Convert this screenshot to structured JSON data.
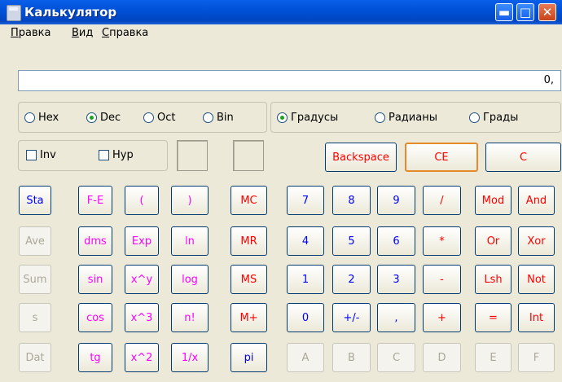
{
  "window": {
    "title": "Калькулятор",
    "icon": "calculator-icon",
    "controls": {
      "minimize": "minimize-icon",
      "maximize": "maximize-icon",
      "close": "close-icon"
    }
  },
  "menu": {
    "items": [
      "Правка",
      "Вид",
      "Справка"
    ]
  },
  "display": {
    "value": "0,"
  },
  "base_group": {
    "options": [
      "Hex",
      "Dec",
      "Oct",
      "Bin"
    ],
    "selected": "Dec"
  },
  "angle_group": {
    "options": [
      "Градусы",
      "Радианы",
      "Грады"
    ],
    "selected": "Градусы"
  },
  "checks": {
    "inv": "Inv",
    "hyp": "Hyp"
  },
  "buttons": {
    "backspace": "Backspace",
    "ce": "CE",
    "c": "C",
    "stat": [
      "Sta",
      "Ave",
      "Sum",
      "s",
      "Dat"
    ],
    "sci": [
      [
        "F-E",
        "(",
        ")"
      ],
      [
        "dms",
        "Exp",
        "ln"
      ],
      [
        "sin",
        "x^y",
        "log"
      ],
      [
        "cos",
        "x^3",
        "n!"
      ],
      [
        "tg",
        "x^2",
        "1/x"
      ]
    ],
    "mem": [
      "MC",
      "MR",
      "MS",
      "M+",
      "pi"
    ],
    "numpad": [
      [
        "7",
        "8",
        "9",
        "/",
        "Mod",
        "And"
      ],
      [
        "4",
        "5",
        "6",
        "*",
        "Or",
        "Xor"
      ],
      [
        "1",
        "2",
        "3",
        "-",
        "Lsh",
        "Not"
      ],
      [
        "0",
        "+/-",
        ",",
        "+",
        "=",
        "Int"
      ],
      [
        "A",
        "B",
        "C",
        "D",
        "E",
        "F"
      ]
    ]
  },
  "colors": {
    "title_bar": "#0054e3",
    "digit": "#0000ff",
    "operator": "#ff0000",
    "function": "#ff00ff",
    "disabled": "#aca899"
  }
}
